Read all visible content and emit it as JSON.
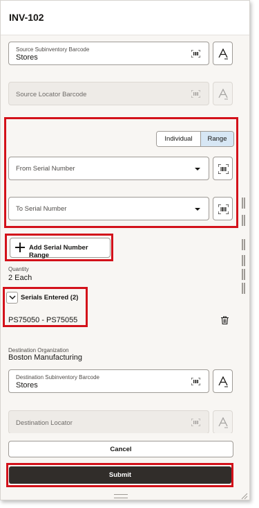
{
  "page": {
    "title": "INV-102"
  },
  "source": {
    "subinventory": {
      "label": "Source Subinventory Barcode",
      "value": "Stores"
    },
    "locator": {
      "placeholder": "Source Locator Barcode"
    }
  },
  "serial_mode": {
    "options": [
      "Individual",
      "Range"
    ],
    "selected": "Range"
  },
  "serial_range": {
    "from_placeholder": "From Serial Number",
    "to_placeholder": "To Serial Number",
    "add_label": "Add Serial Number Range"
  },
  "quantity": {
    "label": "Quantity",
    "value": "2 Each"
  },
  "serials_entered": {
    "label": "Serials Entered (2)",
    "expanded": true,
    "range": "PS75050 - PS75055"
  },
  "destination": {
    "organization": {
      "label": "Destination Organization",
      "value": "Boston Manufacturing"
    },
    "subinventory": {
      "label": "Destination Subinventory Barcode",
      "value": "Stores"
    },
    "locator": {
      "placeholder": "Destination Locator"
    }
  },
  "actions": {
    "cancel_label": "Cancel",
    "submit_label": "Submit"
  },
  "colors": {
    "highlight": "#d3111a",
    "submit_bg": "#312d2a",
    "selected_segment": "#d7e7f5",
    "page_bg": "#f8f6f3"
  },
  "icons": [
    "barcode-scan-icon",
    "keyboard-text-icon",
    "dropdown-caret-icon",
    "plus-icon",
    "chevron-down-icon",
    "trash-icon"
  ]
}
